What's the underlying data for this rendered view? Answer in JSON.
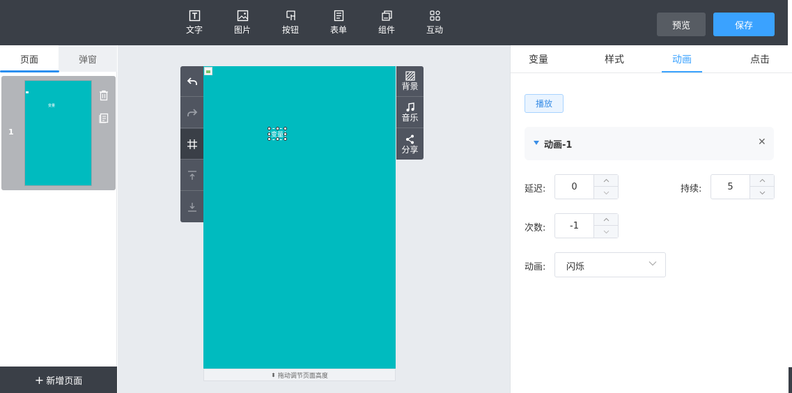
{
  "toolbar": {
    "items": [
      {
        "label": "文字",
        "icon": "text-icon"
      },
      {
        "label": "图片",
        "icon": "image-icon"
      },
      {
        "label": "按钮",
        "icon": "button-icon"
      },
      {
        "label": "表单",
        "icon": "form-icon"
      },
      {
        "label": "组件",
        "icon": "component-icon"
      },
      {
        "label": "互动",
        "icon": "interaction-icon"
      }
    ],
    "preview_label": "预览",
    "save_label": "保存"
  },
  "left_panel": {
    "tabs": [
      {
        "label": "页面",
        "active": true
      },
      {
        "label": "弹窗",
        "active": false
      }
    ],
    "pages": [
      {
        "number": "1",
        "thumb_text": "变量"
      }
    ],
    "add_page_label": "新增页面"
  },
  "canvas": {
    "background_color": "#00bbbf",
    "selected_text": "变量",
    "height_hint": "拖动调节页面高度",
    "side_tools": [
      "undo-icon",
      "redo-icon",
      "grid-icon",
      "align-top-icon",
      "align-bottom-icon"
    ],
    "right_tools": [
      {
        "label": "背景",
        "icon": "background-icon"
      },
      {
        "label": "音乐",
        "icon": "music-icon"
      },
      {
        "label": "分享",
        "icon": "share-icon"
      }
    ]
  },
  "properties": {
    "tabs": [
      {
        "label": "变量",
        "active": false
      },
      {
        "label": "样式",
        "active": false
      },
      {
        "label": "动画",
        "active": true
      },
      {
        "label": "点击",
        "active": false
      }
    ],
    "play_label": "播放",
    "animation": {
      "title": "动画-1",
      "delay_label": "延迟:",
      "delay_value": "0",
      "duration_label": "持续:",
      "duration_value": "5",
      "count_label": "次数:",
      "count_value": "-1",
      "type_label": "动画:",
      "type_value": "闪烁"
    }
  },
  "colors": {
    "topbar": "#3a3f47",
    "accent": "#3aa2ff",
    "canvas_bg": "#00bbbf"
  }
}
